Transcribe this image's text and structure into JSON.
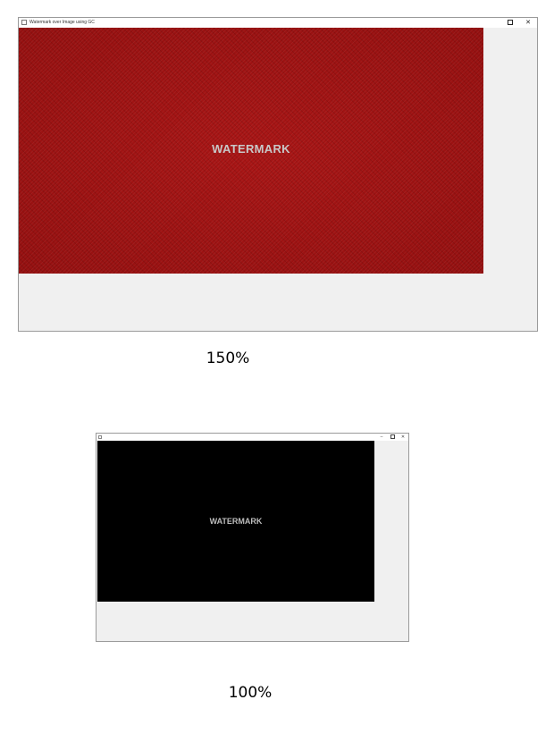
{
  "window_150": {
    "title": "Watermark over Image using GC",
    "maximize_icon": "maximize-icon",
    "close_icon": "close-icon",
    "close_glyph": "✕",
    "image_color": "#9e1111",
    "watermark_text": "WATERMARK"
  },
  "caption_150": "150%",
  "window_100": {
    "minimize_glyph": "–",
    "close_glyph": "✕",
    "image_color": "#000000",
    "watermark_text": "WATERMARK"
  },
  "caption_100": "100%"
}
